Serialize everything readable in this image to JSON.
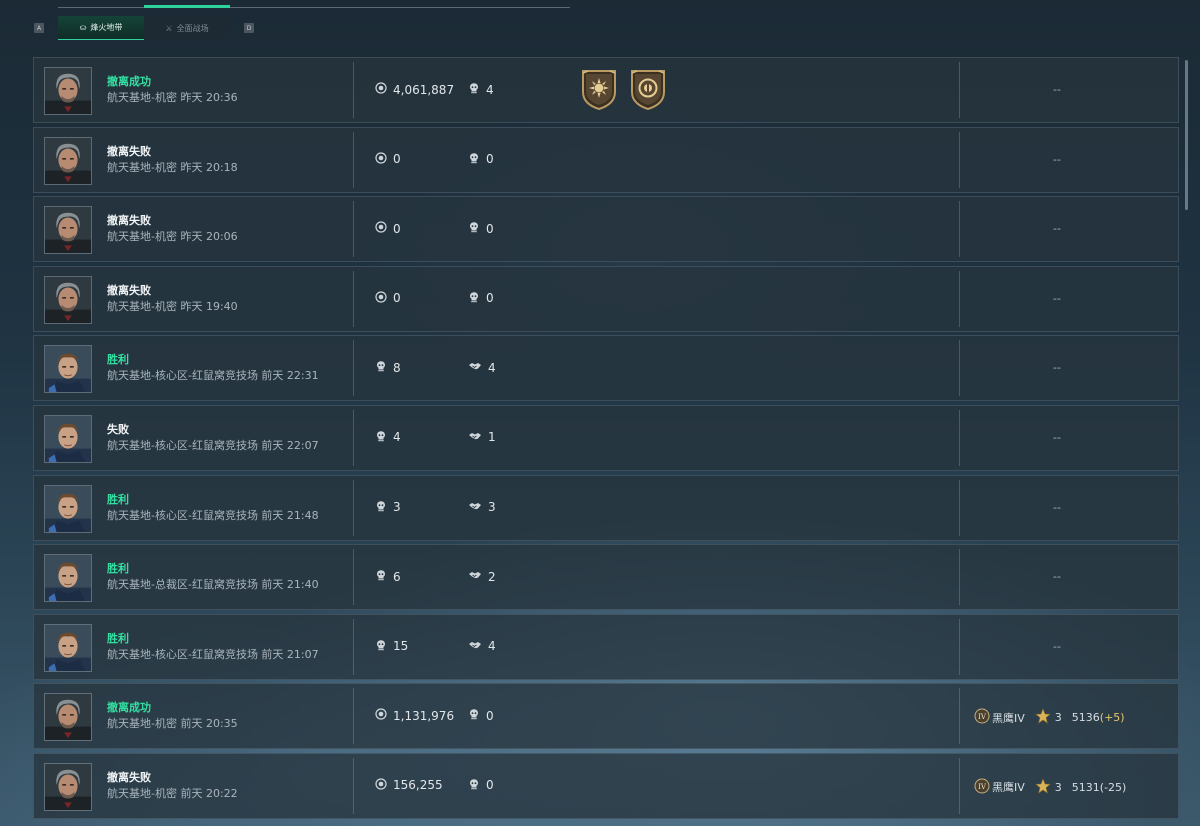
{
  "tabs": {
    "left_key": "A",
    "right_key": "D",
    "items": [
      {
        "label": "烽火地带",
        "active": true,
        "icon": "zone-icon"
      },
      {
        "label": "全面战场",
        "active": false,
        "icon": "battlefield-icon"
      }
    ]
  },
  "colors": {
    "accent": "#2fd39a",
    "success_text": "#33e0a1",
    "positive_delta": "#e7c86a"
  },
  "records": [
    {
      "result": "撤离成功",
      "success": true,
      "subtitle": "航天基地-机密 昨天 20:36",
      "mode": "extraction",
      "stat1": "4,061,887",
      "stat2": "4",
      "badges": [
        "sun-badge-icon",
        "coin-badge-icon"
      ],
      "right": "--"
    },
    {
      "result": "撤离失败",
      "success": false,
      "subtitle": "航天基地-机密 昨天 20:18",
      "mode": "extraction",
      "stat1": "0",
      "stat2": "0",
      "right": "--"
    },
    {
      "result": "撤离失败",
      "success": false,
      "subtitle": "航天基地-机密 昨天 20:06",
      "mode": "extraction",
      "stat1": "0",
      "stat2": "0",
      "right": "--"
    },
    {
      "result": "撤离失败",
      "success": false,
      "subtitle": "航天基地-机密 昨天 19:40",
      "mode": "extraction",
      "stat1": "0",
      "stat2": "0",
      "right": "--"
    },
    {
      "result": "胜利",
      "success": true,
      "subtitle": "航天基地-核心区-红鼠窝竞技场 前天 22:31",
      "mode": "arena",
      "stat1": "8",
      "stat2": "4",
      "right": "--"
    },
    {
      "result": "失败",
      "success": false,
      "subtitle": "航天基地-核心区-红鼠窝竞技场 前天 22:07",
      "mode": "arena",
      "stat1": "4",
      "stat2": "1",
      "right": "--"
    },
    {
      "result": "胜利",
      "success": true,
      "subtitle": "航天基地-核心区-红鼠窝竞技场 前天 21:48",
      "mode": "arena",
      "stat1": "3",
      "stat2": "3",
      "right": "--"
    },
    {
      "result": "胜利",
      "success": true,
      "subtitle": "航天基地-总裁区-红鼠窝竞技场 前天 21:40",
      "mode": "arena",
      "stat1": "6",
      "stat2": "2",
      "right": "--"
    },
    {
      "result": "胜利",
      "success": true,
      "subtitle": "航天基地-核心区-红鼠窝竞技场 前天 21:07",
      "mode": "arena",
      "stat1": "15",
      "stat2": "4",
      "right": "--"
    },
    {
      "result": "撤离成功",
      "success": true,
      "subtitle": "航天基地-机密 前天 20:35",
      "mode": "extraction",
      "stat1": "1,131,976",
      "stat2": "0",
      "rank": {
        "name": "黑鹰IV",
        "stars": "3",
        "score": "5136",
        "delta": "(+5)",
        "delta_positive": true
      }
    },
    {
      "result": "撤离失败",
      "success": false,
      "subtitle": "航天基地-机密 前天 20:22",
      "mode": "extraction",
      "stat1": "156,255",
      "stat2": "0",
      "rank": {
        "name": "黑鹰IV",
        "stars": "3",
        "score": "5131",
        "delta": "(-25)",
        "delta_positive": false
      }
    }
  ]
}
